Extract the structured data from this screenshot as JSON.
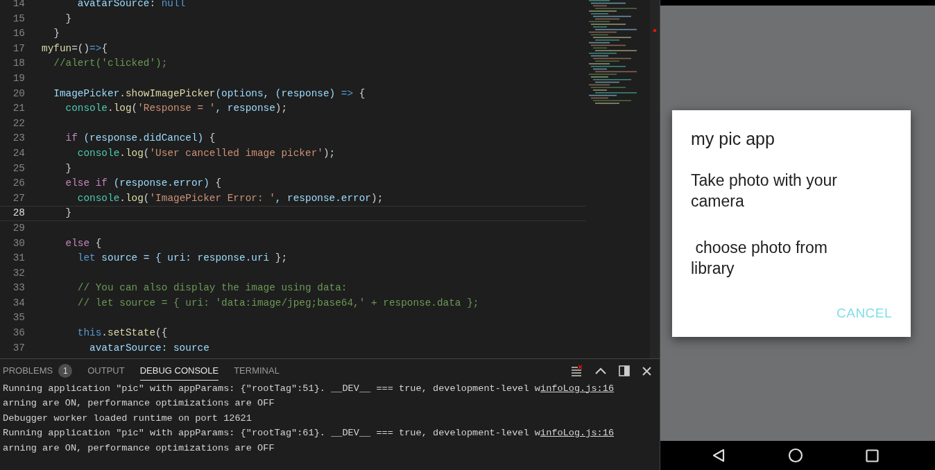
{
  "editor": {
    "lines": [
      {
        "number": "14",
        "current": false,
        "tokens": [
          {
            "text": "      avatarSource: ",
            "kind": "variable"
          },
          {
            "text": "null",
            "kind": "keyword"
          }
        ]
      },
      {
        "number": "15",
        "current": false,
        "tokens": [
          {
            "text": "    }",
            "kind": "plain"
          }
        ]
      },
      {
        "number": "16",
        "current": false,
        "tokens": [
          {
            "text": "  }",
            "kind": "plain"
          }
        ]
      },
      {
        "number": "17",
        "current": false,
        "tokens": [
          {
            "text": "myfun",
            "kind": "function"
          },
          {
            "text": "=()",
            "kind": "plain"
          },
          {
            "text": "=>",
            "kind": "keyword"
          },
          {
            "text": "{",
            "kind": "plain"
          }
        ]
      },
      {
        "number": "18",
        "current": false,
        "tokens": [
          {
            "text": "  //alert('clicked');",
            "kind": "comment"
          }
        ]
      },
      {
        "number": "19",
        "current": false
      },
      {
        "number": "20",
        "current": false,
        "tokens": [
          {
            "text": "  ImagePicker",
            "kind": "variable"
          },
          {
            "text": ".",
            "kind": "plain"
          },
          {
            "text": "showImagePicker",
            "kind": "function"
          },
          {
            "text": "(options, (response) ",
            "kind": "variable"
          },
          {
            "text": "=>",
            "kind": "keyword"
          },
          {
            "text": " {",
            "kind": "plain"
          }
        ]
      },
      {
        "number": "21",
        "current": false,
        "tokens": [
          {
            "text": "    console",
            "kind": "type"
          },
          {
            "text": ".",
            "kind": "plain"
          },
          {
            "text": "log",
            "kind": "function"
          },
          {
            "text": "(",
            "kind": "plain"
          },
          {
            "text": "'Response = '",
            "kind": "string"
          },
          {
            "text": ", response",
            "kind": "variable"
          },
          {
            "text": ");",
            "kind": "plain"
          }
        ]
      },
      {
        "number": "22",
        "current": false
      },
      {
        "number": "23",
        "current": false,
        "tokens": [
          {
            "text": "    if",
            "kind": "control"
          },
          {
            "text": " (response.didCancel) ",
            "kind": "variable"
          },
          {
            "text": "{",
            "kind": "plain"
          }
        ]
      },
      {
        "number": "24",
        "current": false,
        "tokens": [
          {
            "text": "      console",
            "kind": "type"
          },
          {
            "text": ".",
            "kind": "plain"
          },
          {
            "text": "log",
            "kind": "function"
          },
          {
            "text": "(",
            "kind": "plain"
          },
          {
            "text": "'User cancelled image picker'",
            "kind": "string"
          },
          {
            "text": ");",
            "kind": "plain"
          }
        ]
      },
      {
        "number": "25",
        "current": false,
        "tokens": [
          {
            "text": "    }",
            "kind": "plain"
          }
        ]
      },
      {
        "number": "26",
        "current": false,
        "tokens": [
          {
            "text": "    else if",
            "kind": "control"
          },
          {
            "text": " (response.error) ",
            "kind": "variable"
          },
          {
            "text": "{",
            "kind": "plain"
          }
        ]
      },
      {
        "number": "27",
        "current": false,
        "tokens": [
          {
            "text": "      console",
            "kind": "type"
          },
          {
            "text": ".",
            "kind": "plain"
          },
          {
            "text": "log",
            "kind": "function"
          },
          {
            "text": "(",
            "kind": "plain"
          },
          {
            "text": "'ImagePicker Error: '",
            "kind": "string"
          },
          {
            "text": ", response.error",
            "kind": "variable"
          },
          {
            "text": ");",
            "kind": "plain"
          }
        ]
      },
      {
        "number": "28",
        "current": true,
        "tokens": [
          {
            "text": "    }",
            "kind": "plain"
          }
        ]
      },
      {
        "number": "29",
        "current": false
      },
      {
        "number": "30",
        "current": false,
        "tokens": [
          {
            "text": "    else",
            "kind": "control"
          },
          {
            "text": " {",
            "kind": "plain"
          }
        ]
      },
      {
        "number": "31",
        "current": false,
        "tokens": [
          {
            "text": "      let",
            "kind": "keyword"
          },
          {
            "text": " source = { uri: response.uri ",
            "kind": "variable"
          },
          {
            "text": "};",
            "kind": "plain"
          }
        ]
      },
      {
        "number": "32",
        "current": false
      },
      {
        "number": "33",
        "current": false,
        "tokens": [
          {
            "text": "      // You can also display the image using data:",
            "kind": "comment"
          }
        ]
      },
      {
        "number": "34",
        "current": false,
        "tokens": [
          {
            "text": "      // let source = { uri: 'data:image/jpeg;base64,' + response.data };",
            "kind": "comment"
          }
        ]
      },
      {
        "number": "35",
        "current": false
      },
      {
        "number": "36",
        "current": false,
        "tokens": [
          {
            "text": "      this",
            "kind": "keyword"
          },
          {
            "text": ".",
            "kind": "plain"
          },
          {
            "text": "setState",
            "kind": "function"
          },
          {
            "text": "({",
            "kind": "plain"
          }
        ]
      },
      {
        "number": "37",
        "current": false,
        "tokens": [
          {
            "text": "        avatarSource: source",
            "kind": "variable"
          }
        ]
      }
    ]
  },
  "panel": {
    "tabs": [
      {
        "label": "PROBLEMS",
        "selected": false,
        "badge": "1"
      },
      {
        "label": "OUTPUT",
        "selected": false
      },
      {
        "label": "DEBUG CONSOLE",
        "selected": true
      },
      {
        "label": "TERMINAL",
        "selected": false
      }
    ],
    "console_lines": [
      {
        "text": "Running application \"pic\" with appParams: {\"rootTag\":51}. __DEV__ === true, development-level w",
        "link": "infoLog.js:16"
      },
      {
        "text": "arning are ON, performance optimizations are OFF"
      },
      {
        "text": "Debugger worker loaded runtime on port 12621"
      },
      {
        "text": "Running application \"pic\" with appParams: {\"rootTag\":61}. __DEV__ === true, development-level w",
        "link": "infoLog.js:16"
      },
      {
        "text": "arning are ON, performance optimizations are OFF"
      }
    ]
  },
  "phone": {
    "dialog": {
      "title": "my pic app",
      "options": [
        "Take photo with your camera",
        " choose photo from library"
      ],
      "cancel": "CANCEL"
    }
  }
}
